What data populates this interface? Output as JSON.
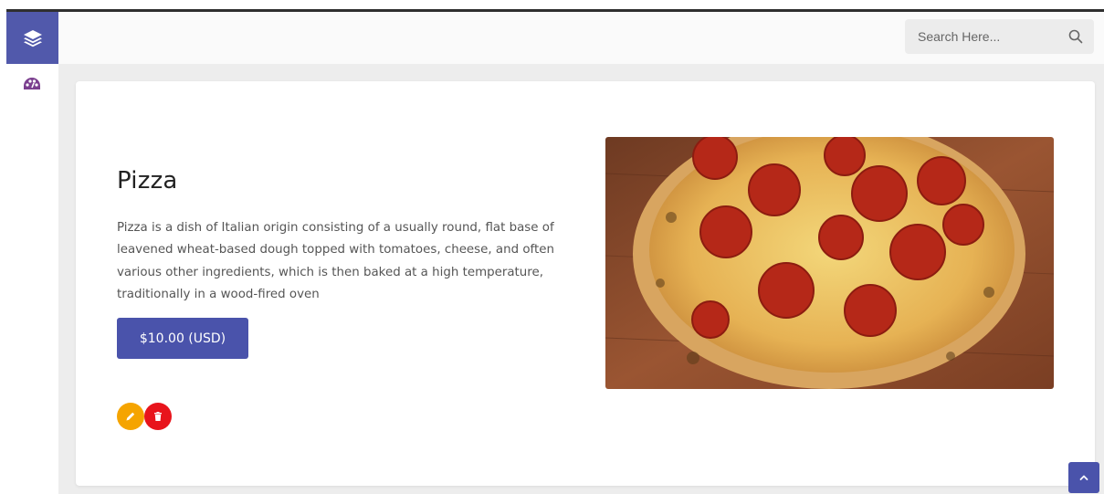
{
  "header": {
    "search_placeholder": "Search Here..."
  },
  "product": {
    "title": "Pizza",
    "description": "Pizza is a dish of Italian origin consisting of a usually round, flat base of leavened wheat-based dough topped with tomatoes, cheese, and often various other ingredients, which is then baked at a high temperature, traditionally in a wood-fired oven",
    "price_label": "$10.00 (USD)"
  },
  "icons": {
    "logo": "layers-icon",
    "dashboard": "palette-icon",
    "search": "search-icon",
    "edit": "pencil-icon",
    "delete": "trash-icon",
    "scroll_top": "chevron-up-icon"
  },
  "colors": {
    "accent": "#4a53ab",
    "sidebar_logo_bg": "#5159ab",
    "dashboard_icon": "#7b3f8f",
    "edit": "#f5a400",
    "delete": "#e8141c",
    "page_bg": "#ededed"
  }
}
